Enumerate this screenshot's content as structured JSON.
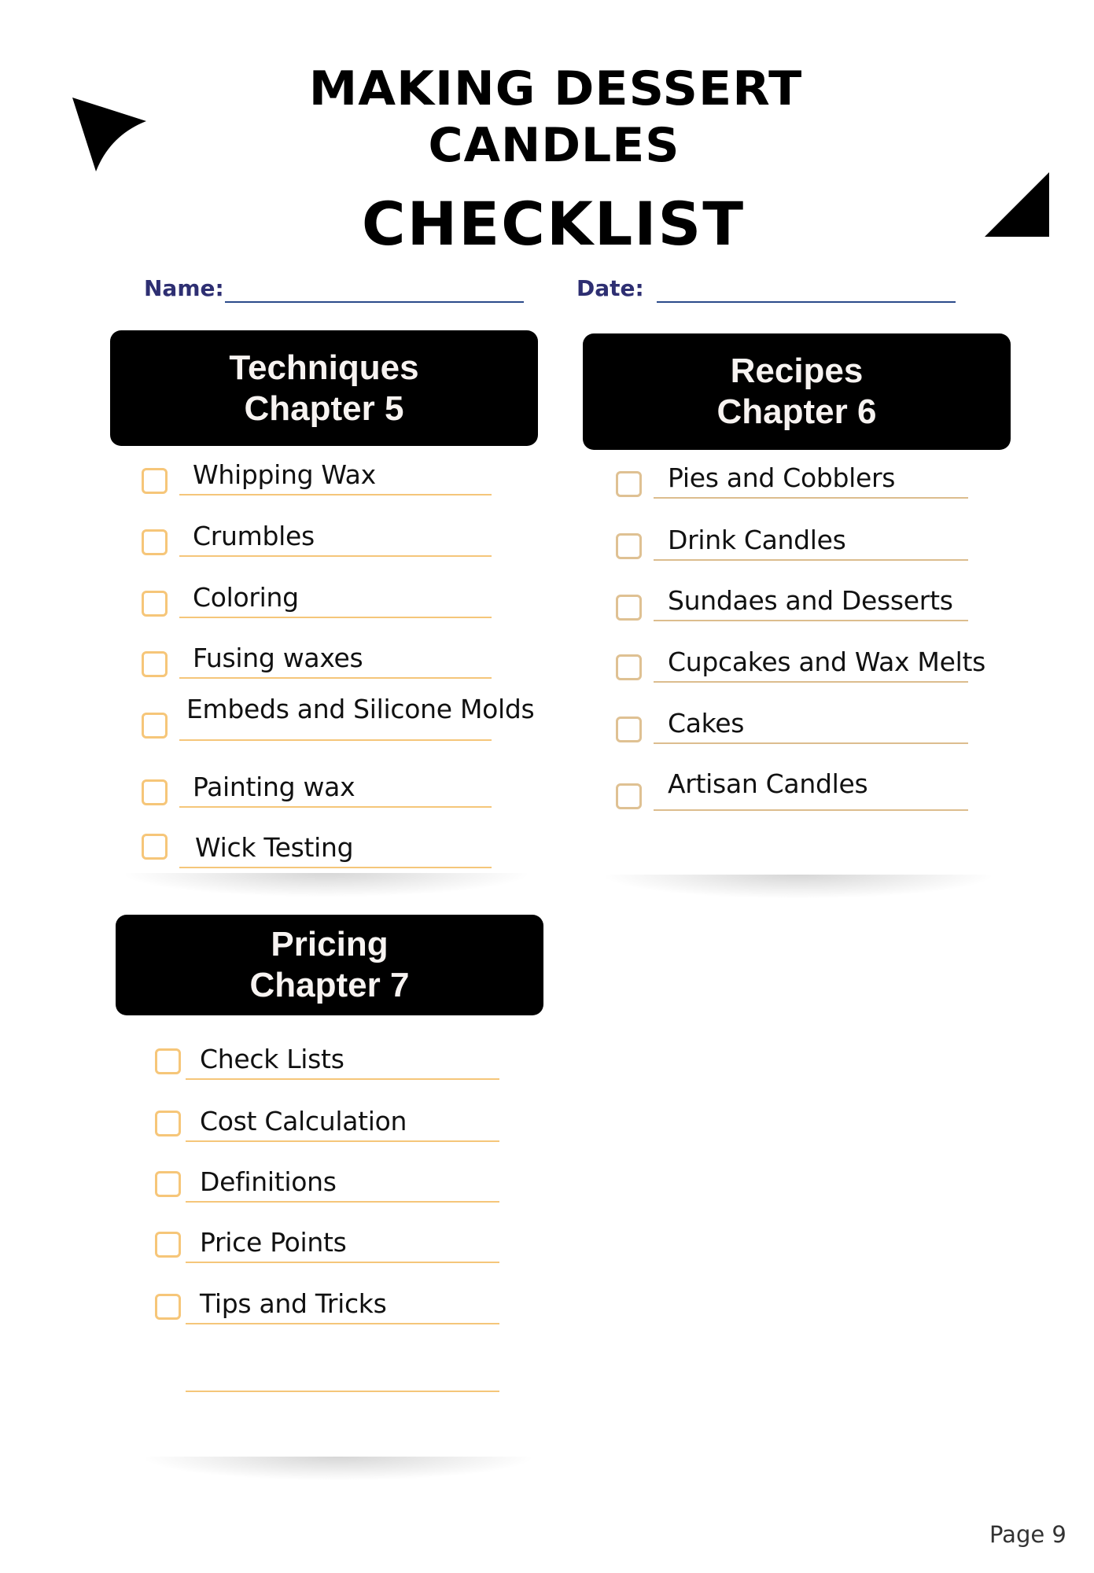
{
  "title": {
    "line1": "MAKING DESSERT",
    "line2": "CANDLES",
    "line3": "CHECKLIST"
  },
  "fields": {
    "name_label": "Name:",
    "name_value": "",
    "date_label": "Date:",
    "date_value": ""
  },
  "sections": {
    "techniques": {
      "title": "Techniques",
      "chapter": "Chapter 5",
      "items": [
        {
          "label": "Whipping Wax",
          "checked": false
        },
        {
          "label": "Crumbles",
          "checked": false
        },
        {
          "label": "Coloring",
          "checked": false
        },
        {
          "label": "Fusing waxes",
          "checked": false
        },
        {
          "label": "Embeds and Silicone Molds",
          "checked": false
        },
        {
          "label": "Painting wax",
          "checked": false
        },
        {
          "label": "Wick Testing",
          "checked": false
        }
      ]
    },
    "recipes": {
      "title": "Recipes",
      "chapter": "Chapter 6",
      "items": [
        {
          "label": "Pies and Cobblers",
          "checked": false
        },
        {
          "label": "Drink Candles",
          "checked": false
        },
        {
          "label": "Sundaes and Desserts",
          "checked": false
        },
        {
          "label": "Cupcakes and Wax Melts",
          "checked": false
        },
        {
          "label": "Cakes",
          "checked": false
        },
        {
          "label": "Artisan Candles",
          "checked": false
        }
      ]
    },
    "pricing": {
      "title": "Pricing",
      "chapter": "Chapter 7",
      "items": [
        {
          "label": "Check Lists",
          "checked": false
        },
        {
          "label": "Cost Calculation",
          "checked": false
        },
        {
          "label": "Definitions",
          "checked": false
        },
        {
          "label": "Price Points",
          "checked": false
        },
        {
          "label": "Tips and Tricks",
          "checked": false
        },
        {
          "label": "",
          "checked": false
        }
      ]
    }
  },
  "footer": {
    "page_label": "Page 9"
  },
  "colors": {
    "heading_box": "#000000",
    "heading_text": "#f7f3f1",
    "field_label": "#2e2f72",
    "field_line": "#2b4a8a",
    "checkbox_orange": "#f6c679",
    "checkbox_tan": "#dfc193"
  }
}
